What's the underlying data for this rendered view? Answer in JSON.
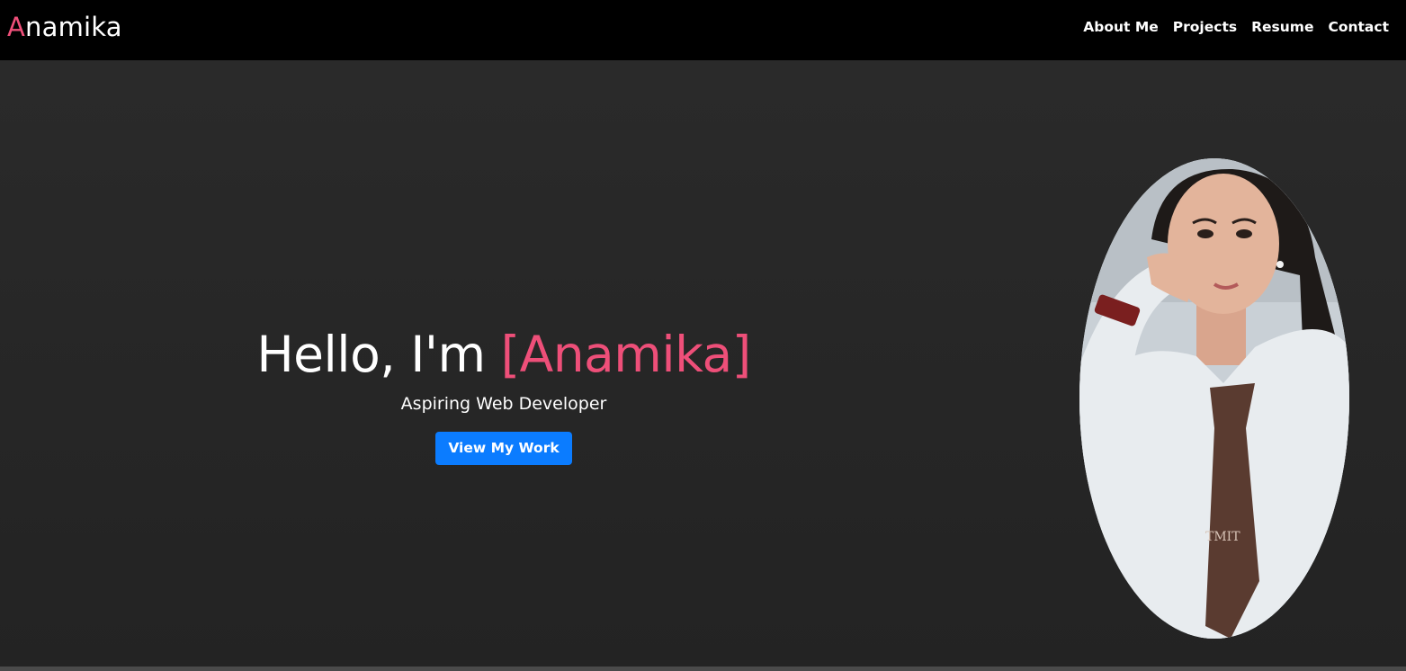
{
  "navbar": {
    "brand": {
      "initial": "A",
      "rest": "namika"
    },
    "links": [
      {
        "label": "About Me"
      },
      {
        "label": "Projects"
      },
      {
        "label": "Resume"
      },
      {
        "label": "Contact"
      }
    ]
  },
  "hero": {
    "greeting": "Hello, I'm ",
    "name_bracketed": "[Anamika]",
    "subtitle": "Aspiring Web Developer",
    "cta_label": "View My Work",
    "portrait_tie_text": "TMIT"
  },
  "colors": {
    "accent": "#ee4f79",
    "button": "#0b7cff",
    "navbar_bg": "#000000",
    "hero_bg": "#262626"
  }
}
